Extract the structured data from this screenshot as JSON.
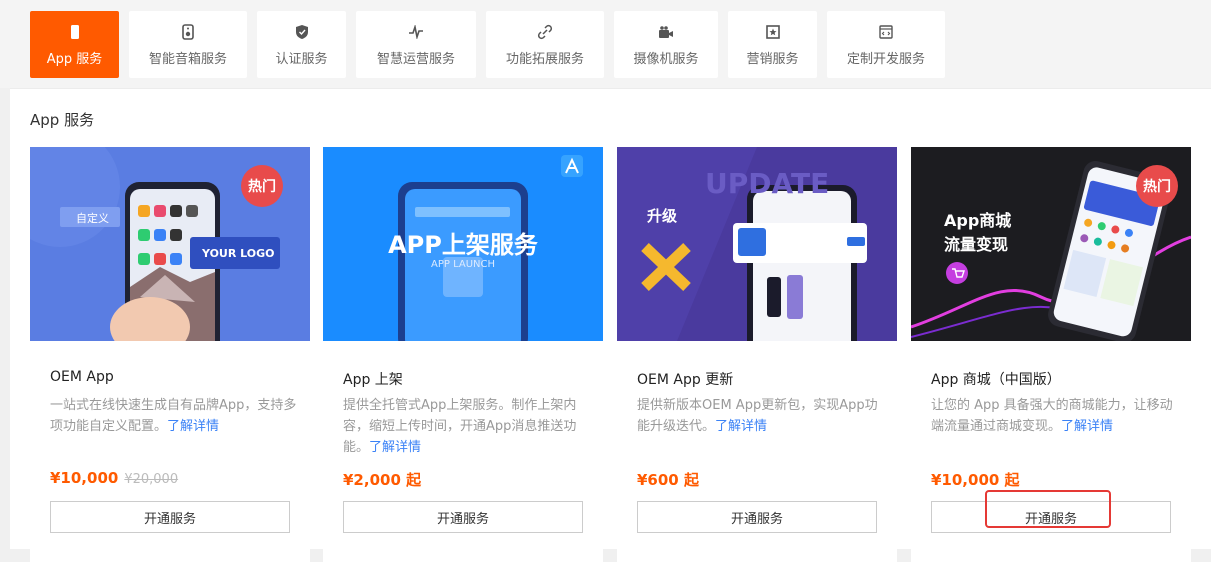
{
  "tabs": [
    {
      "label": "App 服务",
      "icon": "phone-icon"
    },
    {
      "label": "智能音箱服务",
      "icon": "speaker-icon"
    },
    {
      "label": "认证服务",
      "icon": "shield-icon"
    },
    {
      "label": "智慧运营服务",
      "icon": "pulse-icon"
    },
    {
      "label": "功能拓展服务",
      "icon": "link-icon"
    },
    {
      "label": "摄像机服务",
      "icon": "camera-icon"
    },
    {
      "label": "营销服务",
      "icon": "star-icon"
    },
    {
      "label": "定制开发服务",
      "icon": "code-icon"
    }
  ],
  "section_title": "App 服务",
  "cards": [
    {
      "title": "OEM App",
      "desc": "一站式在线快速生成自有品牌App，支持多项功能自定义配置。",
      "link": "了解详情",
      "price": "¥10,000",
      "old_price": "¥20,000",
      "button": "开通服务",
      "hot": "热门",
      "banner": {
        "custom": "自定义",
        "logo": "YOUR LOGO"
      }
    },
    {
      "title": "App 上架",
      "desc": "提供全托管式App上架服务。制作上架内容，缩短上传时间，开通App消息推送功能。",
      "link": "了解详情",
      "price": "¥2,000 起",
      "button": "开通服务",
      "banner": {
        "headline": "APP上架服务",
        "sub": "APP LAUNCH"
      }
    },
    {
      "title": "OEM App 更新",
      "desc": "提供新版本OEM App更新包，实现App功能升级迭代。",
      "link": "了解详情",
      "price": "¥600 起",
      "button": "开通服务",
      "banner": {
        "upgrade": "升级",
        "bg_word": "UPDATE"
      }
    },
    {
      "title": "App 商城（中国版）",
      "desc": "让您的 App 具备强大的商城能力，让移动端流量通过商城变现。",
      "link": "了解详情",
      "price": "¥10,000 起",
      "button": "开通服务",
      "hot": "热门",
      "banner": {
        "line1": "App商城",
        "line2": "流量变现"
      }
    }
  ],
  "colors": {
    "accent": "#ff5a00",
    "link": "#3b82f6",
    "hot": "#e84b4b",
    "highlight": "#e53935"
  }
}
